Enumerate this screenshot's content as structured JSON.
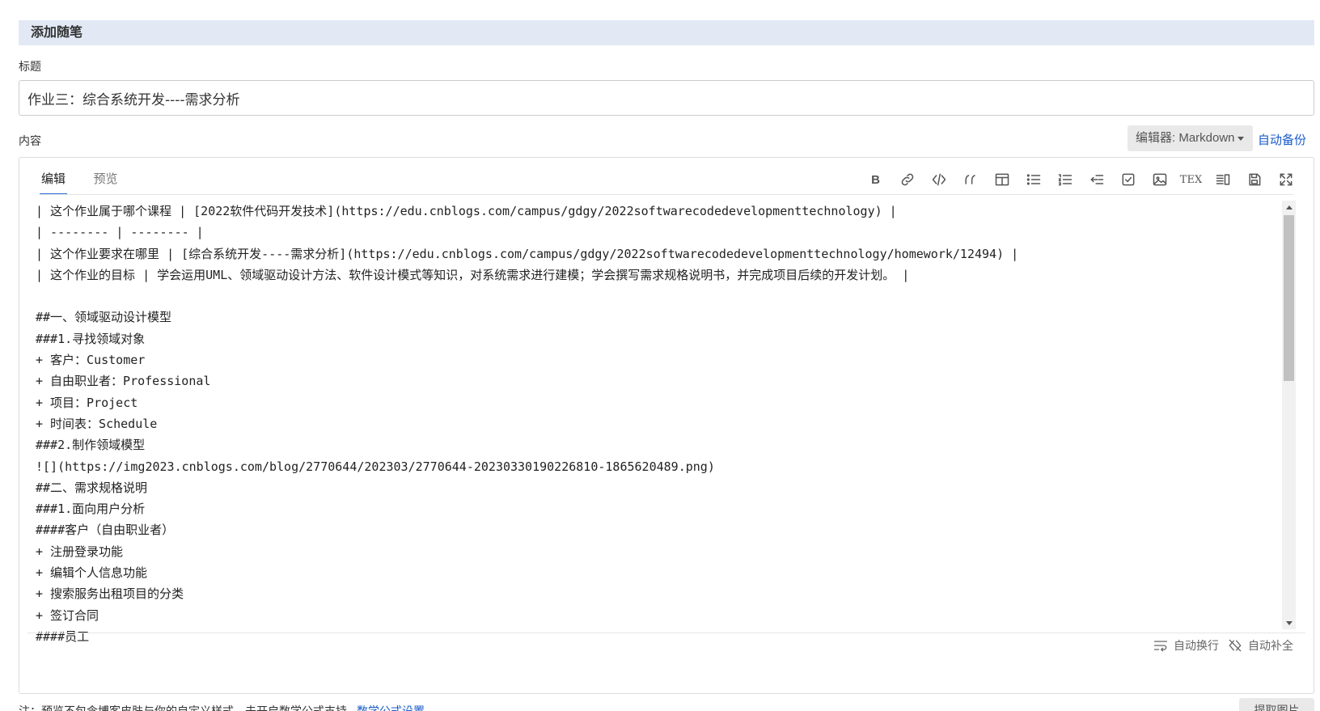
{
  "header": {
    "title": "添加随笔"
  },
  "title_field": {
    "label": "标题",
    "value": "作业三：综合系统开发----需求分析"
  },
  "content_field": {
    "label": "内容"
  },
  "editor_select": {
    "label": "编辑器: Markdown"
  },
  "autosave": {
    "label": "自动备份"
  },
  "tabs": [
    {
      "label": "编辑",
      "active": true
    },
    {
      "label": "预览",
      "active": false
    }
  ],
  "toolbar": {
    "items": [
      {
        "name": "bold-icon",
        "glyph": "B"
      },
      {
        "name": "link-icon"
      },
      {
        "name": "code-icon"
      },
      {
        "name": "quote-icon"
      },
      {
        "name": "table-icon"
      },
      {
        "name": "unordered-list-icon"
      },
      {
        "name": "ordered-list-icon"
      },
      {
        "name": "outdent-icon"
      },
      {
        "name": "checkbox-icon"
      },
      {
        "name": "image-icon"
      },
      {
        "name": "tex-icon",
        "glyph": "TEX"
      },
      {
        "name": "split-view-icon"
      },
      {
        "name": "save-icon"
      },
      {
        "name": "fullscreen-icon"
      }
    ]
  },
  "content_lines": [
    "| 这个作业属于哪个课程 | [2022软件代码开发技术](https://edu.cnblogs.com/campus/gdgy/2022softwarecodedevelopmenttechnology) |",
    "| -------- | -------- |",
    "| 这个作业要求在哪里 | [综合系统开发----需求分析](https://edu.cnblogs.com/campus/gdgy/2022softwarecodedevelopmenttechnology/homework/12494) |",
    "| 这个作业的目标 | 学会运用UML、领域驱动设计方法、软件设计模式等知识，对系统需求进行建模；学会撰写需求规格说明书，并完成项目后续的开发计划。 |",
    "",
    "##一、领域驱动设计模型",
    "###1.寻找领域对象",
    "+ 客户：Customer",
    "+ 自由职业者：Professional",
    "+ 项目：Project",
    "+ 时间表：Schedule",
    "###2.制作领域模型",
    "![](https://img2023.cnblogs.com/blog/2770644/202303/2770644-20230330190226810-1865620489.png)",
    "##二、需求规格说明",
    "###1.面向用户分析",
    "####客户（自由职业者）",
    "+ 注册登录功能",
    "+ 编辑个人信息功能",
    "+ 搜索服务出租项目的分类",
    "+ 签订合同",
    "####员工"
  ],
  "footer": {
    "auto_wrap": "自动换行",
    "auto_complete": "自动补全"
  },
  "note": {
    "text": "注：预览不包含博客皮肤与你的自定义样式，未开启数学公式支持",
    "math_link": "数学公式设置"
  },
  "fetch_button": {
    "label": "提取图片"
  }
}
